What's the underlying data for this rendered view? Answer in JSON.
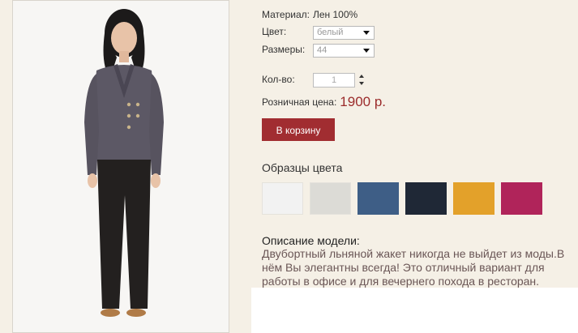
{
  "product": {
    "photo_alt": "product-photo",
    "material_label": "Материал:",
    "material_value": "Лен 100%",
    "color_label": "Цвет:",
    "color_selected": "белый",
    "size_label": "Размеры:",
    "size_selected": "44",
    "qty_label": "Кол-во:",
    "qty_value": "1",
    "price_label": "Розничная цена:",
    "price_value": "1900 р.",
    "cart_button": "В корзину"
  },
  "swatches": {
    "title": "Образцы цвета",
    "colors": [
      "#f2f2f2",
      "#dcdbd6",
      "#3e5e86",
      "#1f2836",
      "#e3a12a",
      "#b0245a"
    ]
  },
  "description": {
    "title": "Описание модели:",
    "text": "Двубортный льняной жакет никогда не выйдет из моды.В нём Вы элегантны всегда! Это отличный вариант для работы в офисе и для вечернего похода в ресторан."
  }
}
